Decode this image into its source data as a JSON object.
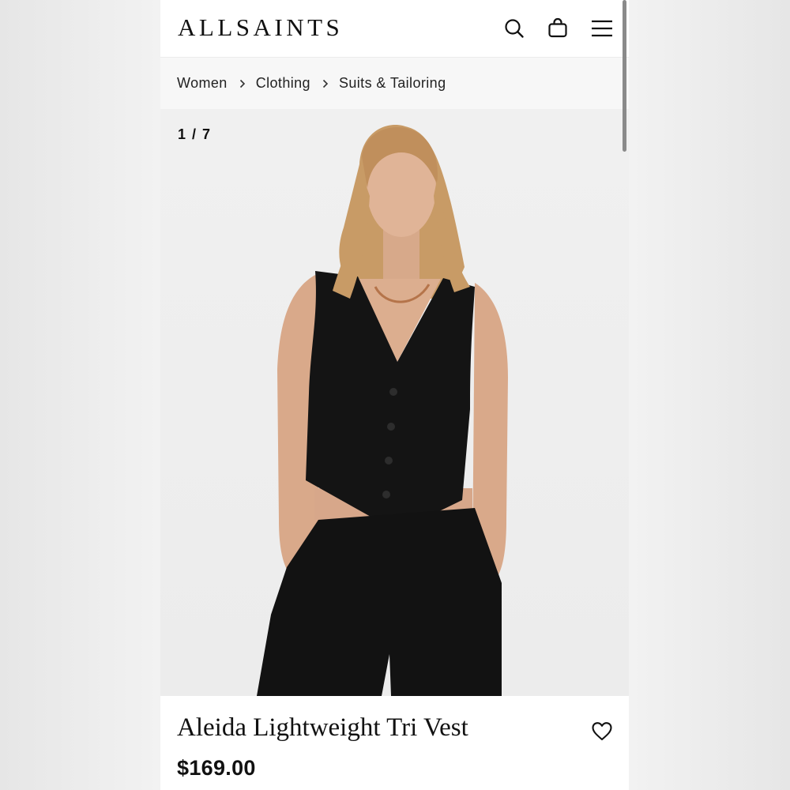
{
  "header": {
    "logo": "ALLSAINTS",
    "icons": [
      "search-icon",
      "shopping-bag-icon",
      "menu-icon"
    ]
  },
  "breadcrumb": {
    "items": [
      {
        "label": "Women"
      },
      {
        "label": "Clothing"
      },
      {
        "label": "Suits & Tailoring"
      }
    ]
  },
  "gallery": {
    "counter": "1 / 7"
  },
  "product": {
    "title": "Aleida Lightweight Tri Vest",
    "price": "$169.00"
  },
  "colors": {
    "text": "#111111",
    "garment": "#141414",
    "background": "#ececec"
  }
}
